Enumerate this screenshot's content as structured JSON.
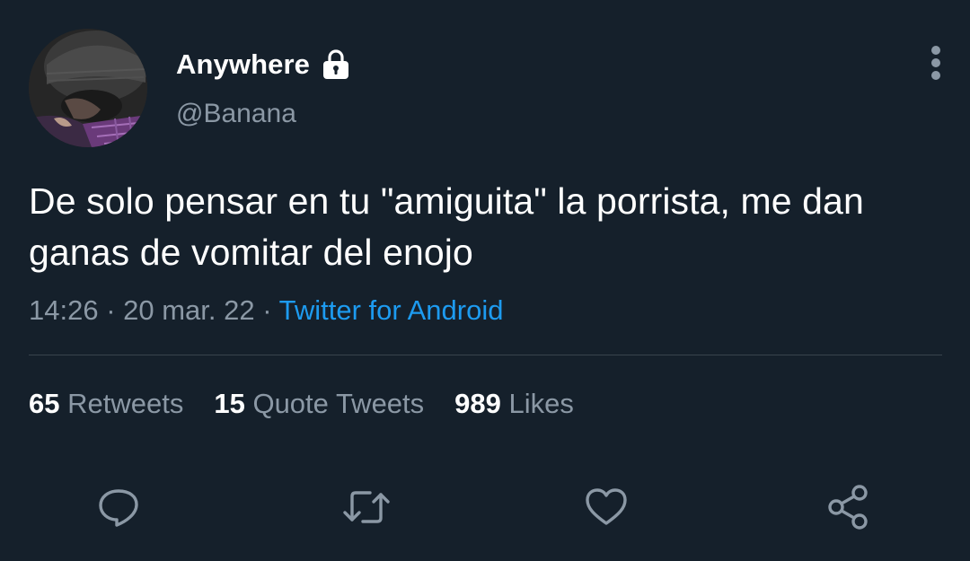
{
  "tweet": {
    "display_name": "Anywhere",
    "handle": "@Banana",
    "text": "De solo pensar en tu \"amiguita\" la porrista, me dan ganas de vomitar del enojo",
    "time": "14:26",
    "separator": "·",
    "date": "20 mar. 22",
    "source": "Twitter for Android"
  },
  "stats": {
    "retweets_count": "65",
    "retweets_label": "Retweets",
    "quotes_count": "15",
    "quotes_label": "Quote Tweets",
    "likes_count": "989",
    "likes_label": "Likes"
  },
  "icons": {
    "lock": "lock-icon",
    "more": "more-vertical-icon",
    "reply": "reply-icon",
    "retweet": "retweet-icon",
    "like": "heart-icon",
    "share": "share-icon"
  },
  "colors": {
    "background": "#15202b",
    "text_primary": "#ffffff",
    "text_secondary": "#8b98a5",
    "link": "#1d9bf0",
    "divider": "#38444d"
  }
}
